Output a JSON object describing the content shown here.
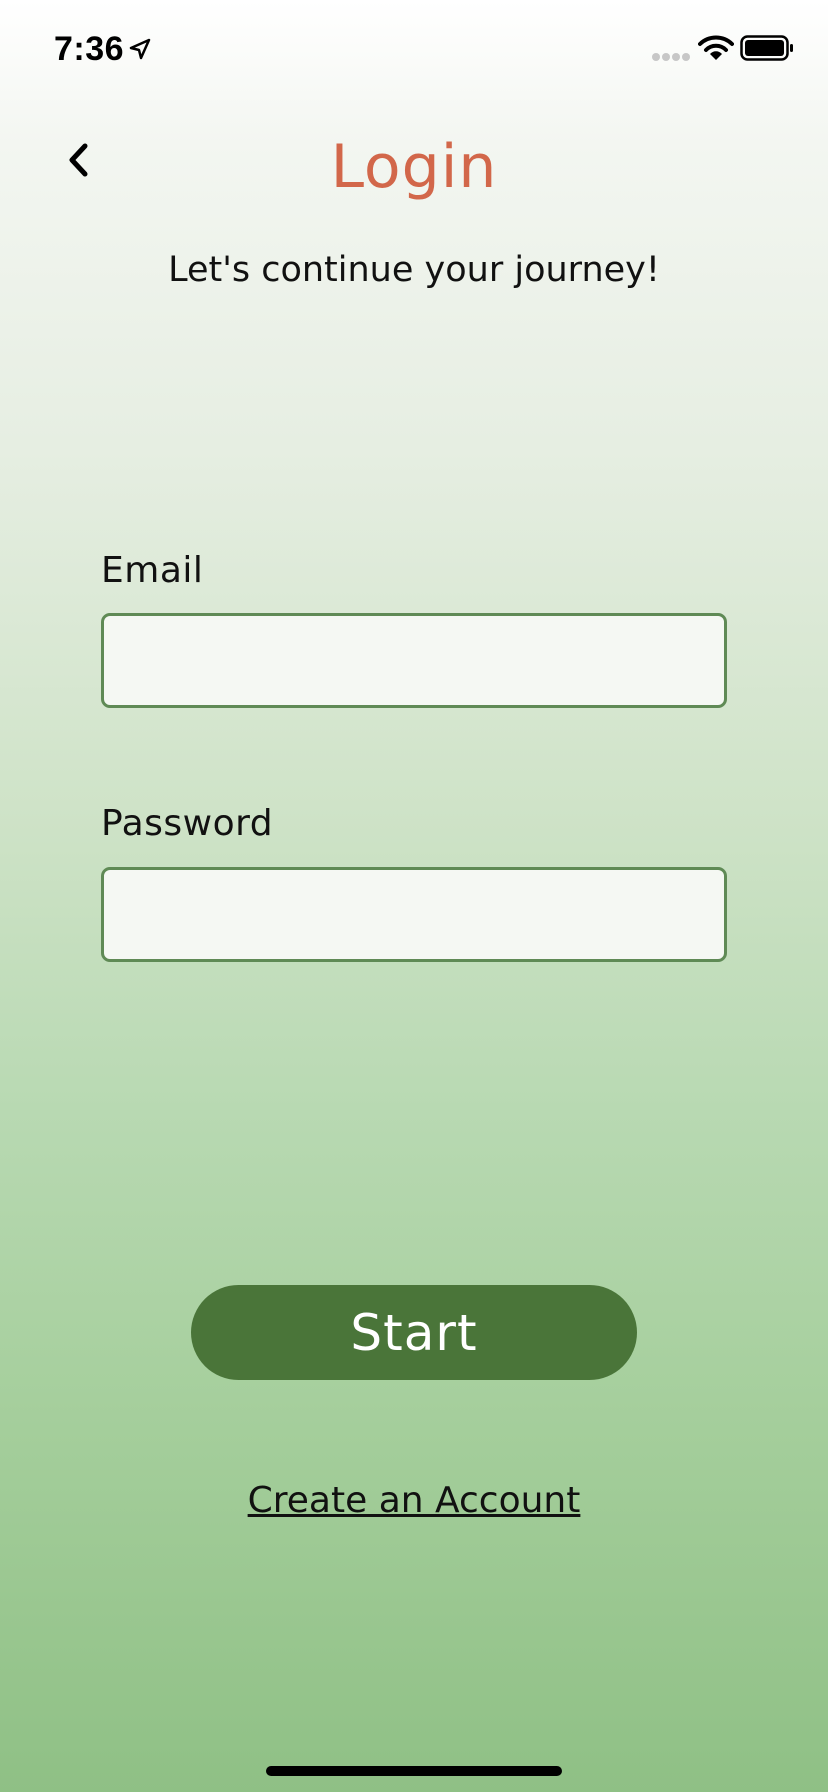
{
  "status_bar": {
    "time": "7:36",
    "icons": [
      "location-arrow-icon",
      "cellular-signal-icon",
      "wifi-icon",
      "battery-icon"
    ]
  },
  "header": {
    "back_icon": "chevron-left-icon",
    "title": "Login",
    "subtitle": "Let's continue your journey!"
  },
  "form": {
    "email_label": "Email",
    "email_value": "",
    "password_label": "Password",
    "password_value": ""
  },
  "actions": {
    "start_label": "Start",
    "create_account_label": "Create an Account"
  },
  "colors": {
    "title": "#d2674a",
    "button": "#4a7539",
    "field_border": "#5f8a55",
    "gradient_top": "#ffffff",
    "gradient_bottom": "#8fc085"
  }
}
